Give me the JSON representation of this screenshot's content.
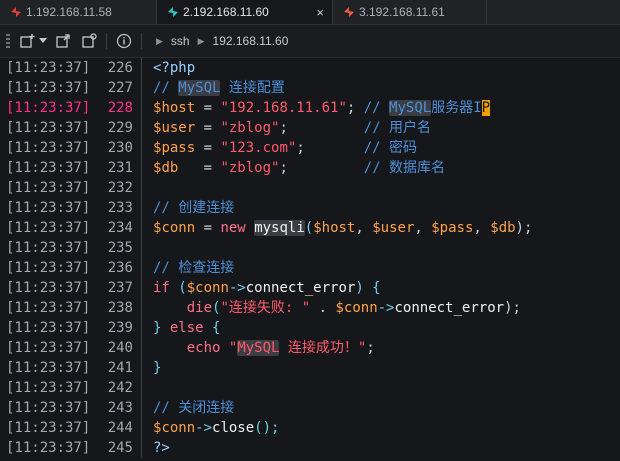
{
  "tabs": [
    {
      "label": "1.192.168.11.58",
      "icon": "bolt-icon",
      "color": "#e23b3b"
    },
    {
      "label": "2.192.168.11.60",
      "icon": "bolt-icon",
      "color": "#2ec4c4",
      "active": true,
      "close": "×"
    },
    {
      "label": "3.192.168.11.61",
      "icon": "bolt-icon",
      "color": "#f05a3a"
    }
  ],
  "toolbar": {
    "breadcrumb": [
      "ssh",
      "192.168.11.60"
    ]
  },
  "timestamp": "[11:23:37]",
  "lines": [
    {
      "n": "226",
      "c": [
        "<?php"
      ]
    },
    {
      "n": "227",
      "c": [
        "// ",
        "MySQL",
        " 连接配置"
      ]
    },
    {
      "n": "228",
      "c": [
        "$",
        "host",
        " = ",
        "\"192.168.11.61\"",
        "; ",
        "// ",
        "MySQL",
        "服务器I",
        "P"
      ]
    },
    {
      "n": "229",
      "c": [
        "$",
        "user",
        " = ",
        "\"zblog\"",
        ";         ",
        "// 用户名"
      ]
    },
    {
      "n": "230",
      "c": [
        "$",
        "pass",
        " = ",
        "\"123.com\"",
        ";       ",
        "// 密码"
      ]
    },
    {
      "n": "231",
      "c": [
        "$",
        "db",
        "   = ",
        "\"zblog\"",
        ";         ",
        "// 数据库名"
      ]
    },
    {
      "n": "232",
      "c": [
        ""
      ]
    },
    {
      "n": "233",
      "c": [
        "// 创建连接"
      ]
    },
    {
      "n": "234",
      "c": [
        "$",
        "conn",
        " = ",
        "new",
        " ",
        "mysqli",
        "(",
        "$",
        "host",
        ", ",
        "$",
        "user",
        ", ",
        "$",
        "pass",
        ", ",
        "$",
        "db",
        ");"
      ]
    },
    {
      "n": "235",
      "c": [
        ""
      ]
    },
    {
      "n": "236",
      "c": [
        "// 检查连接"
      ]
    },
    {
      "n": "237",
      "c": [
        "if",
        " (",
        "$",
        "conn",
        "->",
        "connect_error",
        ") {"
      ]
    },
    {
      "n": "238",
      "c": [
        "    ",
        "die",
        "(",
        "\"连接失败: \"",
        " . ",
        "$",
        "conn",
        "->",
        "connect_error",
        ");"
      ]
    },
    {
      "n": "239",
      "c": [
        "} ",
        "else",
        " {"
      ]
    },
    {
      "n": "240",
      "c": [
        "    ",
        "echo",
        " ",
        "\"",
        "MySQL",
        " 连接成功！\"",
        ";"
      ]
    },
    {
      "n": "241",
      "c": [
        "}"
      ]
    },
    {
      "n": "242",
      "c": [
        ""
      ]
    },
    {
      "n": "243",
      "c": [
        "// 关闭连接"
      ]
    },
    {
      "n": "244",
      "c": [
        "$",
        "conn",
        "->",
        "close",
        "();"
      ]
    },
    {
      "n": "245",
      "c": [
        "?>"
      ]
    }
  ]
}
